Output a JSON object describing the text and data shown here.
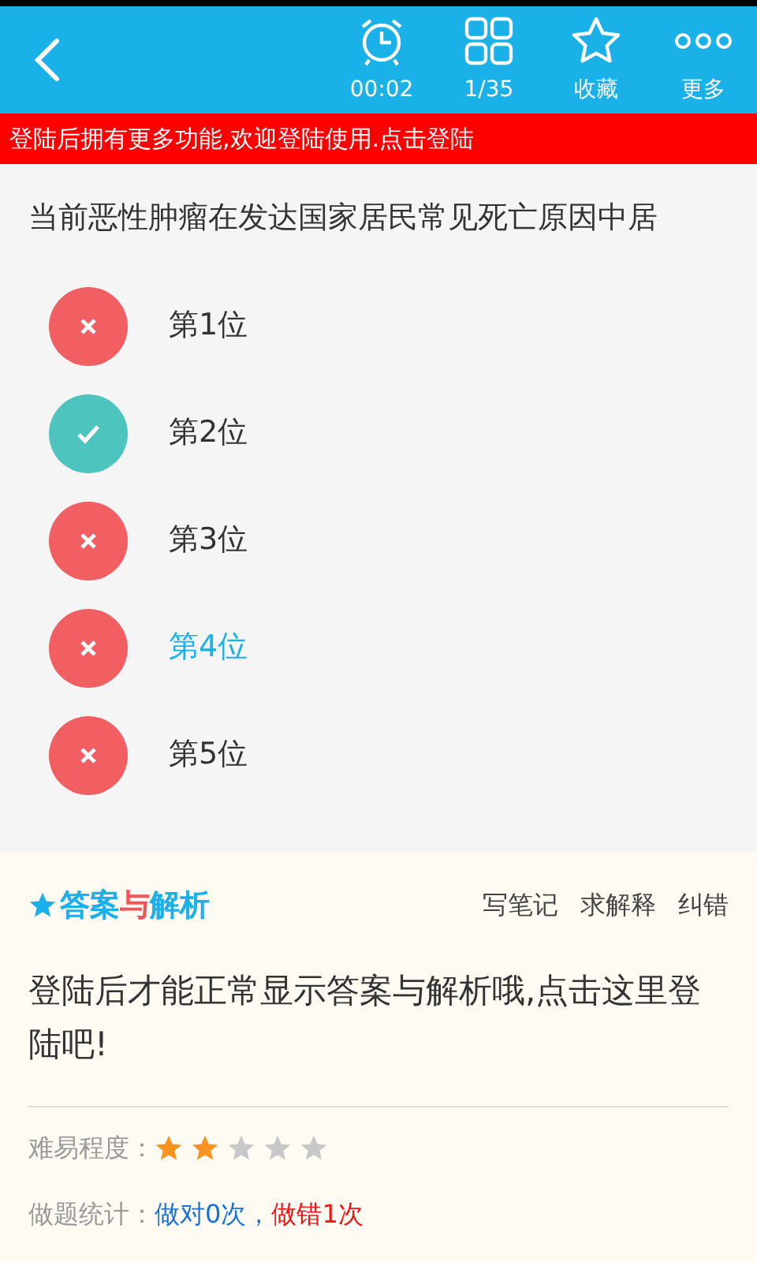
{
  "toolbar": {
    "items": [
      {
        "kind": "clock",
        "label": "00:02"
      },
      {
        "kind": "grid",
        "label": "1/35"
      },
      {
        "kind": "star",
        "label": "收藏"
      },
      {
        "kind": "more",
        "label": "更多"
      }
    ]
  },
  "login_banner": "登陆后拥有更多功能,欢迎登陆使用.点击登陆",
  "question": "当前恶性肿瘤在发达国家居民常见死亡原因中居",
  "options": [
    {
      "label": "第1位",
      "kind": "wrong",
      "selected": false
    },
    {
      "label": "第2位",
      "kind": "correct",
      "selected": false
    },
    {
      "label": "第3位",
      "kind": "wrong",
      "selected": false
    },
    {
      "label": "第4位",
      "kind": "wrong",
      "selected": true
    },
    {
      "label": "第5位",
      "kind": "wrong",
      "selected": false
    }
  ],
  "answer": {
    "heading": [
      {
        "text": "答案",
        "color": "#1ab0e8"
      },
      {
        "text": "与",
        "color": "#f0555a"
      },
      {
        "text": "解析",
        "color": "#1ab0e8"
      }
    ],
    "actions": [
      "写笔记",
      "求解释",
      "纠错"
    ],
    "message": "登陆后才能正常显示答案与解析哦,点击这里登陆吧!",
    "difficulty": {
      "label": "难易程度：",
      "stars": 2
    },
    "stats": {
      "label": "做题统计：",
      "parts": [
        {
          "text": "做对0次",
          "color": "#1a73d9"
        },
        {
          "text": "，",
          "color": "#1a73d9"
        },
        {
          "text": "做错1次",
          "color": "#f01515"
        }
      ]
    }
  }
}
